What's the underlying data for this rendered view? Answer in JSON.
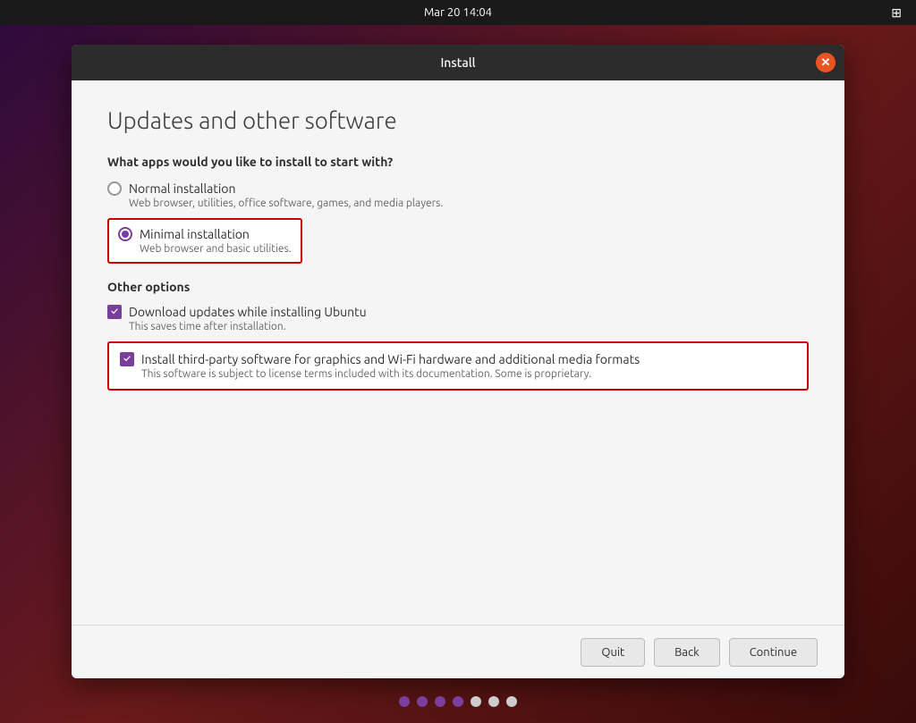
{
  "topbar": {
    "time": "Mar 20  14:04",
    "network_icon": "network-icon"
  },
  "window": {
    "title": "Install",
    "close_label": "✕"
  },
  "page": {
    "title": "Updates and other software",
    "question": "What apps would you like to install to start with?",
    "installation_options": [
      {
        "id": "normal",
        "label": "Normal installation",
        "description": "Web browser, utilities, office software, games, and media players.",
        "selected": false
      },
      {
        "id": "minimal",
        "label": "Minimal installation",
        "description": "Web browser and basic utilities.",
        "selected": true
      }
    ],
    "other_options_label": "Other options",
    "checkboxes": [
      {
        "id": "updates",
        "label": "Download updates while installing Ubuntu",
        "description": "This saves time after installation.",
        "checked": true,
        "highlighted": false
      },
      {
        "id": "third_party",
        "label": "Install third-party software for graphics and Wi-Fi hardware and additional media formats",
        "description": "This software is subject to license terms included with its documentation. Some is proprietary.",
        "checked": true,
        "highlighted": true
      }
    ],
    "buttons": {
      "quit": "Quit",
      "back": "Back",
      "continue": "Continue"
    },
    "progress_dots": [
      {
        "filled": true
      },
      {
        "filled": true
      },
      {
        "filled": true
      },
      {
        "filled": true
      },
      {
        "filled": false
      },
      {
        "filled": false
      },
      {
        "filled": false
      }
    ]
  }
}
